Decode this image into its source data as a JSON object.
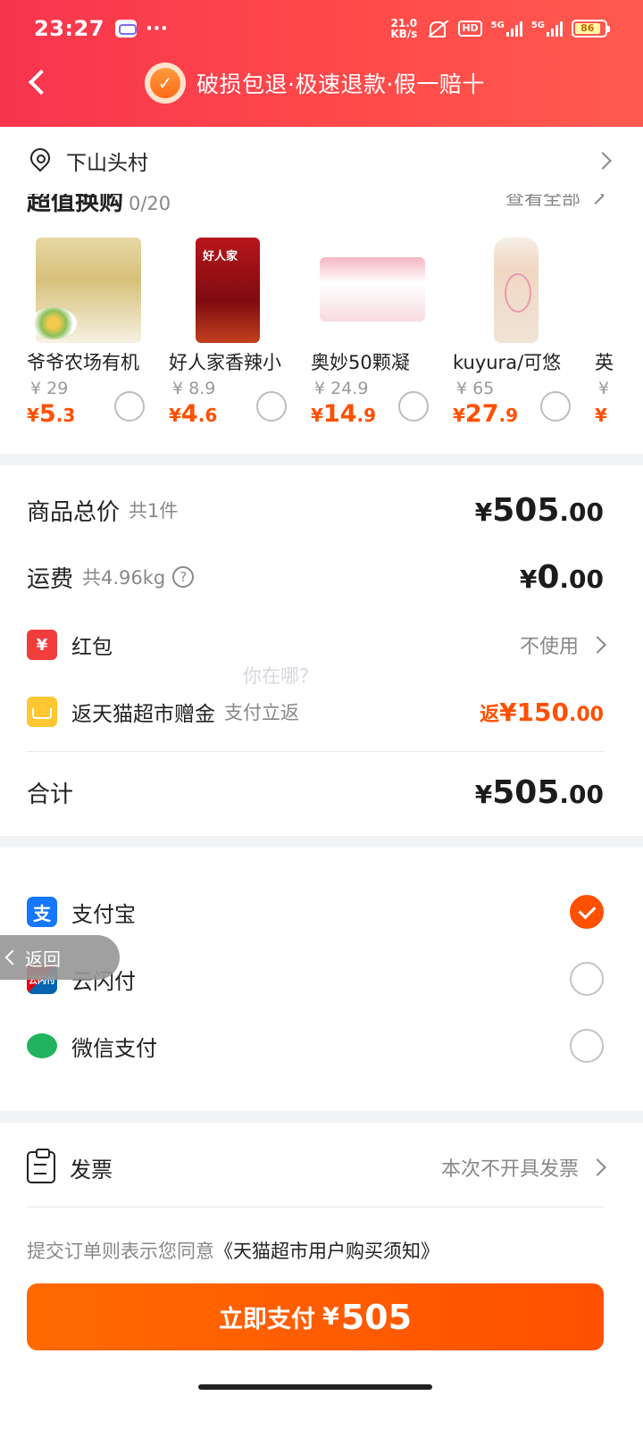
{
  "status_bar": {
    "time": "23:27",
    "dots": "···",
    "net_speed_value": "21.0",
    "net_speed_unit": "KB/s",
    "hd_label": "HD",
    "network_1": "5G",
    "network_2": "5G",
    "battery": "86"
  },
  "header": {
    "guarantee_text": "破损包退·极速退款·假一赔十"
  },
  "address": {
    "text": "下山头村"
  },
  "upsell": {
    "title": "超值换购",
    "count": "0/20",
    "view_all": "查看全部",
    "products": [
      {
        "name": "爷爷农场有机",
        "orig_price": "¥ 29",
        "price_int": "5",
        "price_dec": ".3"
      },
      {
        "name": "好人家香辣小",
        "orig_price": "¥ 8.9",
        "price_int": "4",
        "price_dec": ".6"
      },
      {
        "name": "奥妙50颗凝",
        "orig_price": "¥ 24.9",
        "price_int": "14",
        "price_dec": ".9"
      },
      {
        "name": "kuyura/可悠",
        "orig_price": "¥ 65",
        "price_int": "27",
        "price_dec": ".9"
      },
      {
        "name": "英",
        "orig_price": "¥",
        "price_int": "",
        "price_dec": ""
      }
    ],
    "currency": "¥"
  },
  "summary": {
    "goods_total_label": "商品总价",
    "goods_count": "共1件",
    "goods_total_int": "505",
    "goods_total_dec": ".00",
    "shipping_label": "运费",
    "shipping_weight": "共4.96kg",
    "shipping_help": "?",
    "shipping_int": "0",
    "shipping_dec": ".00",
    "redpacket_label": "红包",
    "redpacket_value": "不使用",
    "rebate_label": "返天猫超市赠金",
    "rebate_note": "支付立返",
    "rebate_prefix": "返",
    "rebate_int": "150",
    "rebate_dec": ".00",
    "ghost_hint": "你在哪？",
    "total_label": "合计",
    "total_int": "505",
    "total_dec": ".00",
    "currency": "¥"
  },
  "payment": {
    "methods": [
      {
        "name": "支付宝",
        "selected": true,
        "icon": "alipay-icon"
      },
      {
        "name": "云闪付",
        "selected": false,
        "icon": "unionpay-icon"
      },
      {
        "name": "微信支付",
        "selected": false,
        "icon": "wechat-pay-icon"
      }
    ],
    "alipay_glyph": "支",
    "union_glyph": "云闪付"
  },
  "floating_back": {
    "label": "返回"
  },
  "invoice": {
    "label": "发票",
    "value": "本次不开具发票"
  },
  "agreement": {
    "prefix": "提交订单则表示您同意",
    "link": "《天猫超市用户购买须知》"
  },
  "submit": {
    "label": "立即支付",
    "currency": "¥",
    "amount": "505"
  },
  "colors": {
    "accent": "#ff5000",
    "header_red": "#f7354e",
    "alipay_blue": "#1677ff",
    "wechat_green": "#22b35e"
  }
}
